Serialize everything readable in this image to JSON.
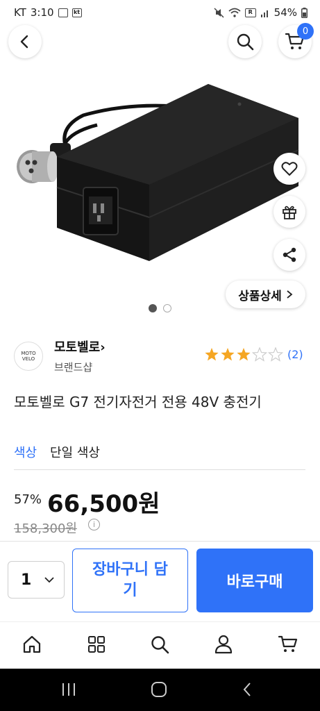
{
  "status_bar": {
    "carrier": "KT",
    "time": "3:10",
    "battery": "54%"
  },
  "header": {
    "cart_count": "0"
  },
  "image": {
    "carousel_total": 2,
    "carousel_active": 1,
    "detail_label": "상품상세"
  },
  "brand": {
    "logo_text": "MOTO VELO",
    "name": "모토벨로",
    "sub": "브랜드샵"
  },
  "rating": {
    "stars": 3,
    "max": 5,
    "count": "(2)"
  },
  "product": {
    "title": "모토벨로 G7 전기자전거 전용 48V 충전기",
    "option_label": "색상",
    "option_value": "단일 색상"
  },
  "price": {
    "discount": "57%",
    "sale": "66,500원",
    "original": "158,300원"
  },
  "purchase": {
    "quantity": "1",
    "cart_label": "장바구니 담기",
    "buy_label": "바로구매"
  },
  "colors": {
    "accent": "#2f72f8",
    "star": "#f5a623"
  },
  "nav": [
    "home-icon",
    "category-icon",
    "search-icon",
    "my-page-icon",
    "cart-icon"
  ]
}
